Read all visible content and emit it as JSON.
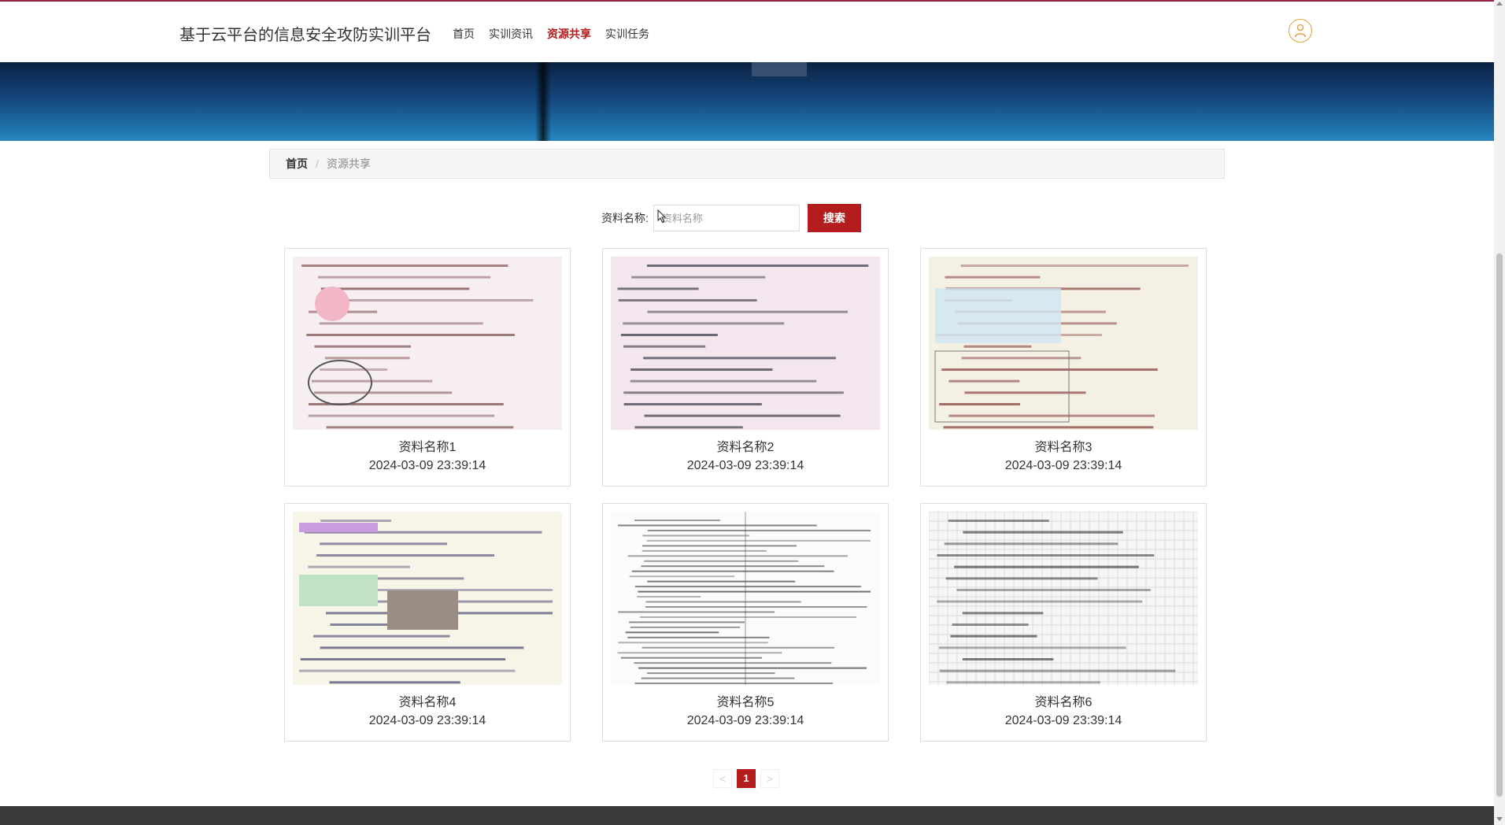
{
  "header": {
    "site_title": "基于云平台的信息安全攻防实训平台",
    "nav": [
      {
        "label": "首页",
        "active": false
      },
      {
        "label": "实训资讯",
        "active": false
      },
      {
        "label": "资源共享",
        "active": true
      },
      {
        "label": "实训任务",
        "active": false
      }
    ],
    "user_icon": "user-circle-icon"
  },
  "breadcrumb": {
    "home": "首页",
    "separator": "/",
    "current": "资源共享"
  },
  "search": {
    "label": "资料名称:",
    "placeholder": "资料名称",
    "value": "",
    "button": "搜索"
  },
  "resources": [
    {
      "name": "资料名称1",
      "date": "2024-03-09 23:39:14",
      "thumb_bg": "#f7eef2",
      "ink": "#6b3a3a"
    },
    {
      "name": "资料名称2",
      "date": "2024-03-09 23:39:14",
      "thumb_bg": "#f4e6ef",
      "ink": "#2b2b3a"
    },
    {
      "name": "资料名称3",
      "date": "2024-03-09 23:39:14",
      "thumb_bg": "#f4f1e4",
      "ink": "#7a2a2a"
    },
    {
      "name": "资料名称4",
      "date": "2024-03-09 23:39:14",
      "thumb_bg": "#f7f4e8",
      "ink": "#3d3a6a"
    },
    {
      "name": "资料名称5",
      "date": "2024-03-09 23:39:14",
      "thumb_bg": "#fbfbfb",
      "ink": "#333333"
    },
    {
      "name": "资料名称6",
      "date": "2024-03-09 23:39:14",
      "thumb_bg": "#f6f6f6",
      "ink": "#3a3a3a"
    }
  ],
  "pagination": {
    "prev": "<",
    "current_page": "1",
    "next": ">"
  },
  "colors": {
    "accent": "#b31d1d",
    "banner": "#1f5f96",
    "footer": "#3a3a3a"
  }
}
